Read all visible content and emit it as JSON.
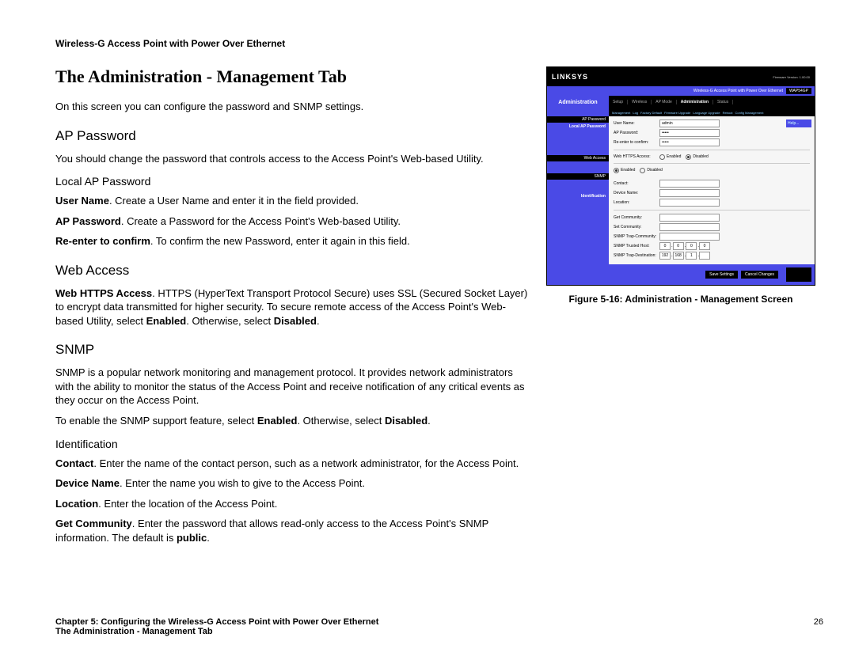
{
  "header": "Wireless-G Access Point with Power Over Ethernet",
  "title": "The Administration - Management Tab",
  "intro": "On this screen you can configure the password and SNMP settings.",
  "sections": {
    "ap_password": {
      "heading": "AP Password",
      "intro": "You should change the password that controls access to the Access Point's Web-based Utility.",
      "sub_heading": "Local AP Password",
      "p1_b": "User Name",
      "p1_t": ". Create a User Name and enter it in the field provided.",
      "p2_b": "AP Password",
      "p2_t": ". Create a Password for the Access Point's Web-based Utility.",
      "p3_b": "Re-enter to confirm",
      "p3_t": ". To confirm the new Password, enter it again in this field."
    },
    "web_access": {
      "heading": "Web Access",
      "p1_b": "Web HTTPS Access",
      "p1_t1": ". HTTPS (HyperText Transport Protocol Secure) uses SSL (Secured Socket Layer) to encrypt data transmitted for higher security. To secure remote access of the Access Point's Web-based Utility, select ",
      "p1_b2": "Enabled",
      "p1_t2": ". Otherwise, select ",
      "p1_b3": "Disabled",
      "p1_t3": "."
    },
    "snmp": {
      "heading": "SNMP",
      "intro": "SNMP is a popular network monitoring and management protocol. It provides network administrators with the ability to monitor the status of the Access Point and receive notification of any critical events as they occur on the Access Point.",
      "p2a": "To enable the SNMP support feature, select ",
      "p2b": "Enabled",
      "p2c": ". Otherwise, select ",
      "p2d": "Disabled",
      "p2e": ".",
      "sub_heading": "Identification",
      "c_b": "Contact",
      "c_t": ". Enter the name of the contact person, such as a network administrator, for the Access Point.",
      "d_b": "Device Name",
      "d_t": ". Enter the name you wish to give to the Access Point.",
      "l_b": "Location",
      "l_t": ". Enter the location of the Access Point.",
      "g_b": "Get Community",
      "g_t1": ". Enter the password that allows read-only access to the Access Point's SNMP information. The default is ",
      "g_b2": "public",
      "g_t2": "."
    }
  },
  "figure": {
    "caption": "Figure 5-16: Administration - Management Screen",
    "brand": "LINKSYS",
    "product": "Wireless-G Access Point",
    "product_sub": " with Power Over Ethernet",
    "model": "WAP54GP",
    "nav_side": "Administration",
    "tabs": [
      "Setup",
      "Wireless",
      "AP Mode",
      "Administration",
      "Status"
    ],
    "subnav": [
      "Management",
      "Log",
      "Factory Default",
      "Firmware Upgrade",
      "Language Upgrade",
      "Reboot",
      "Config Management"
    ],
    "side_headers": [
      "AP Password",
      "Web Access",
      "SNMP"
    ],
    "side_sub": [
      "Local AP Password",
      "Identification"
    ],
    "fields": {
      "user_name_lab": "User Name:",
      "user_name_val": "admin",
      "ap_password_lab": "AP Password:",
      "ap_password_val": "•••••",
      "reenter_lab": "Re-enter to confirm:",
      "reenter_val": "•••••",
      "https_lab": "Web HTTPS Access:",
      "enabled": "Enabled",
      "disabled": "Disabled",
      "contact_lab": "Contact:",
      "device_lab": "Device Name:",
      "location_lab": "Location:",
      "getc_lab": "Get Community:",
      "setc_lab": "Set Community:",
      "trapc_lab": "SNMP Trap-Community:",
      "trusted_lab": "SNMP Trusted Host:",
      "trapdest_lab": "SNMP Trap-Destination:",
      "ip0": "0",
      "ip1": "0",
      "ip2": "0",
      "ip3": "0",
      "td0": "192",
      "td1": "168",
      "td2": "1",
      "td3": ""
    },
    "help": "Help...",
    "btn_save": "Save Settings",
    "btn_cancel": "Cancel Changes"
  },
  "footer": {
    "chapter": "Chapter 5: Configuring the Wireless-G Access Point with Power Over Ethernet",
    "subtitle": "The Administration - Management Tab",
    "page": "26"
  }
}
